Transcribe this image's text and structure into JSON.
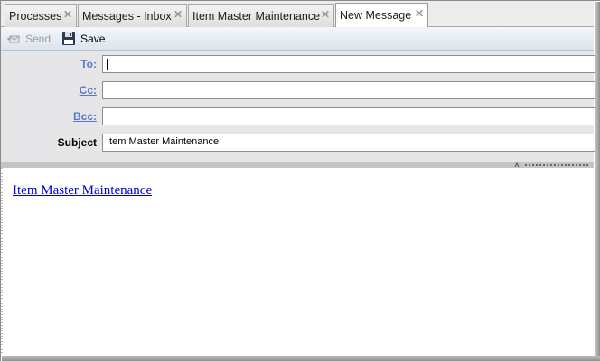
{
  "tabs": [
    {
      "label": "Processes",
      "close": "✕"
    },
    {
      "label": "Messages - Inbox",
      "close": "✕"
    },
    {
      "label": "Item Master Maintenance",
      "close": "✕"
    },
    {
      "label": "New Message",
      "close": "✕"
    }
  ],
  "toolbar": {
    "send_label": "Send",
    "save_label": "Save"
  },
  "form": {
    "to_label": "To:",
    "cc_label": "Cc:",
    "bcc_label": "Bcc:",
    "subject_label": "Subject",
    "to_value": "",
    "cc_value": "",
    "bcc_value": "",
    "subject_value": "Item Master Maintenance"
  },
  "body": {
    "link_text": "Item Master Maintenance"
  },
  "colors": {
    "link_blue": "#0000cc",
    "label_link": "#5a78c8",
    "header_bg": "#e6e6e8"
  }
}
